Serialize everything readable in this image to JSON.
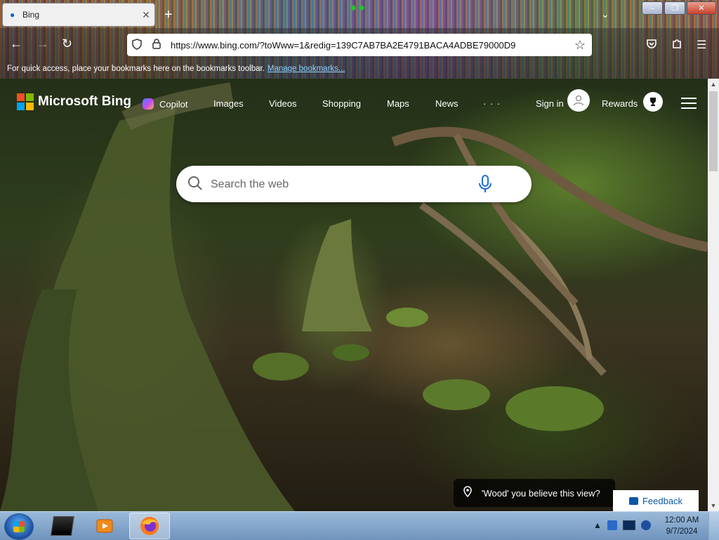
{
  "browser": {
    "tab_title": "Bing",
    "tab_close": "✕",
    "new_tab": "+",
    "url": "https://www.bing.com/?toWww=1&redig=139C7AB7BA2E4791BACA4ADBE79000D9",
    "bookmarks_note": "For quick access, place your bookmarks here on the bookmarks toolbar.",
    "manage_bookmarks": "Manage bookmarks..."
  },
  "bing": {
    "brand": "Microsoft Bing",
    "nav": [
      "Copilot",
      "Images",
      "Videos",
      "Shopping",
      "Maps",
      "News",
      "· · ·"
    ],
    "sign_in": "Sign in",
    "rewards": "Rewards",
    "search_placeholder": "Search the web",
    "image_caption": "'Wood' you believe this view?",
    "feedback": "Feedback"
  },
  "taskbar": {
    "time": "12:00 AM",
    "date": "9/7/2024"
  },
  "colors": {
    "ms_red": "#f25022",
    "ms_green": "#7fba00",
    "ms_blue": "#00a4ef",
    "ms_yellow": "#ffb900",
    "feedback_blue": "#0b57a8"
  }
}
